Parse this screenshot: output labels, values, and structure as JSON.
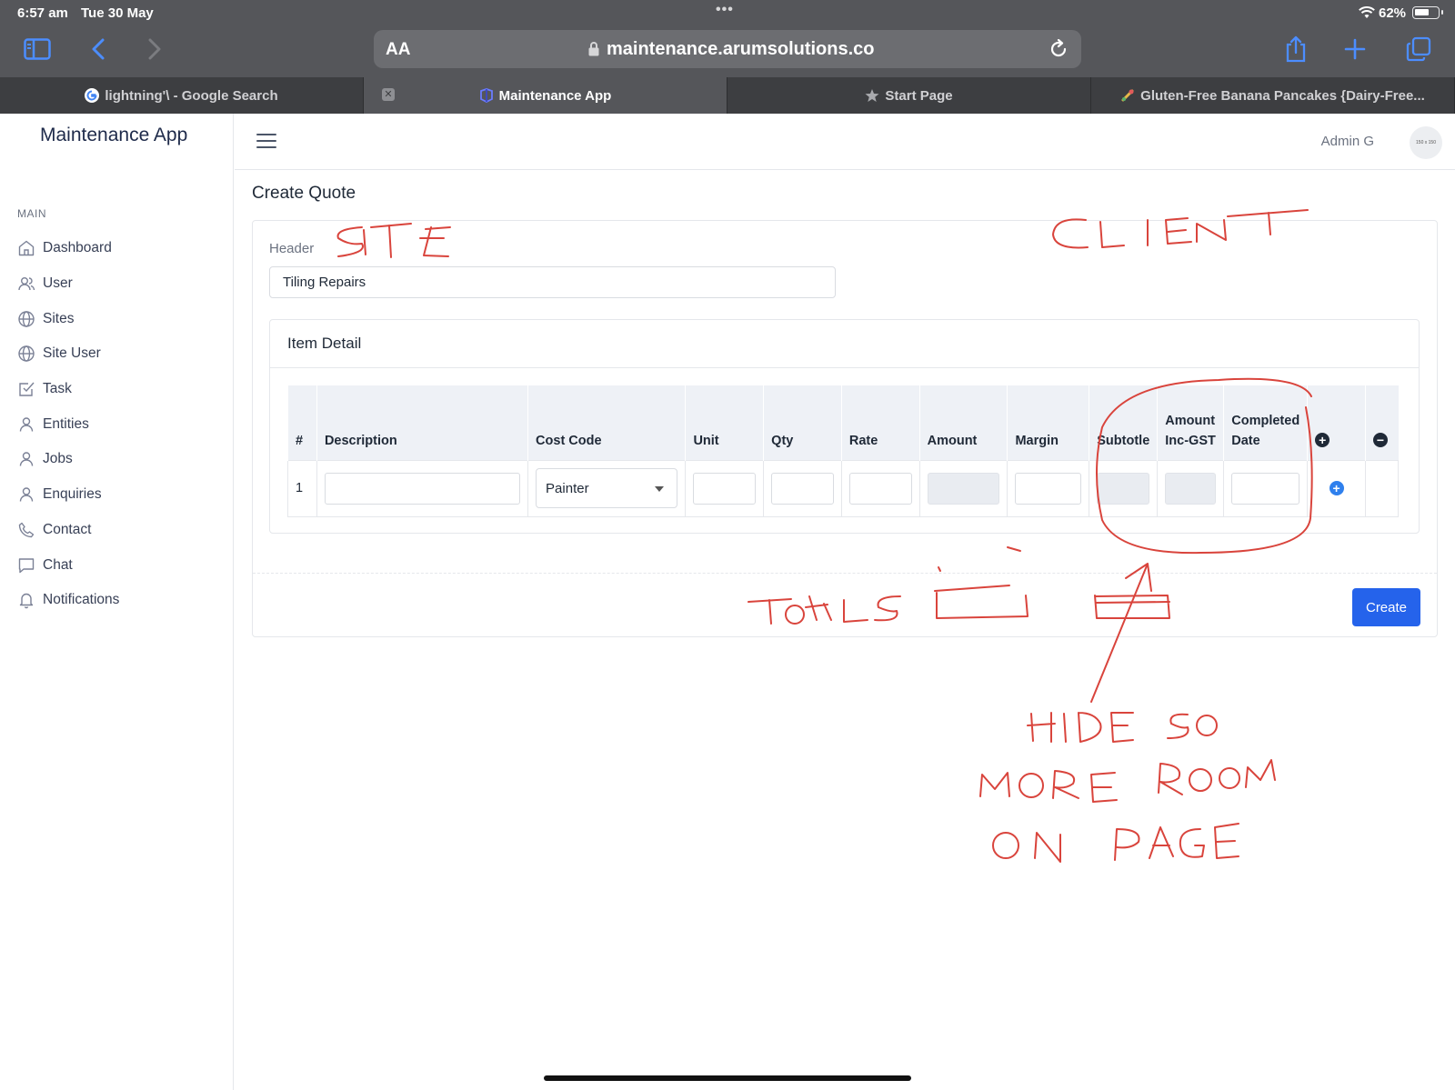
{
  "status": {
    "time": "6:57 am",
    "date": "Tue 30 May",
    "battery": "62%"
  },
  "browser": {
    "aa_label": "AA",
    "url": "maintenance.arumsolutions.co",
    "tabs": [
      {
        "title": "lightning'\\ - Google Search",
        "active": false
      },
      {
        "title": "Maintenance App",
        "active": true
      },
      {
        "title": "Start Page",
        "active": false
      },
      {
        "title": "Gluten-Free Banana Pancakes {Dairy-Free...",
        "active": false
      }
    ]
  },
  "app": {
    "brand": "Maintenance App",
    "section_label": "MAIN",
    "nav": [
      {
        "label": "Dashboard",
        "icon": "home-icon"
      },
      {
        "label": "User",
        "icon": "users-icon"
      },
      {
        "label": "Sites",
        "icon": "globe-icon"
      },
      {
        "label": "Site User",
        "icon": "globe-icon"
      },
      {
        "label": "Task",
        "icon": "checkbox-icon"
      },
      {
        "label": "Entities",
        "icon": "user-icon"
      },
      {
        "label": "Jobs",
        "icon": "user-icon"
      },
      {
        "label": "Enquiries",
        "icon": "user-icon"
      },
      {
        "label": "Contact",
        "icon": "phone-icon"
      },
      {
        "label": "Chat",
        "icon": "chat-icon"
      },
      {
        "label": "Notifications",
        "icon": "bell-icon"
      }
    ],
    "user_name": "Admin G",
    "avatar_text": "150 x 150"
  },
  "page": {
    "title": "Create Quote",
    "header_label": "Header",
    "header_value": "Tiling Repairs",
    "item_detail_title": "Item Detail",
    "columns": [
      "#",
      "Description",
      "Cost Code",
      "Unit",
      "Qty",
      "Rate",
      "Amount",
      "Margin",
      "Subtotle",
      "Amount Inc-GST",
      "Completed Date"
    ],
    "rows": [
      {
        "num": "1",
        "cost_code": "Painter"
      }
    ],
    "create_label": "Create"
  },
  "annotations": {
    "site": "SITE",
    "client": "CLIENT",
    "totals": "TOTALS",
    "note_line1": "HIDE SO",
    "note_line2": "MORE ROOM",
    "note_line3": "ON PAGE",
    "ink_color": "#d9443c"
  },
  "colors": {
    "accent": "#2563eb",
    "browser_chrome": "#55565a",
    "brand_text": "#1e2a4a"
  }
}
